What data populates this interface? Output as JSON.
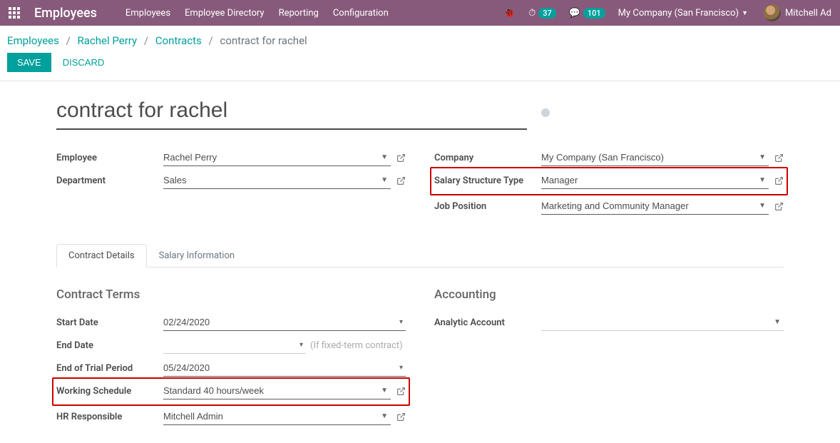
{
  "topbar": {
    "app_title": "Employees",
    "nav": [
      "Employees",
      "Employee Directory",
      "Reporting",
      "Configuration"
    ],
    "clock_count": "37",
    "chat_count": "101",
    "company": "My Company (San Francisco)",
    "user": "Mitchell Ad"
  },
  "breadcrumb": {
    "items": [
      "Employees",
      "Rachel Perry",
      "Contracts"
    ],
    "current": "contract for rachel"
  },
  "actions": {
    "save": "SAVE",
    "discard": "DISCARD"
  },
  "record": {
    "title": "contract for rachel"
  },
  "left_fields": {
    "employee": {
      "label": "Employee",
      "value": "Rachel Perry"
    },
    "department": {
      "label": "Department",
      "value": "Sales"
    }
  },
  "right_fields": {
    "company": {
      "label": "Company",
      "value": "My Company (San Francisco)"
    },
    "salary_structure": {
      "label": "Salary Structure Type",
      "value": "Manager"
    },
    "job_position": {
      "label": "Job Position",
      "value": "Marketing and Community Manager"
    }
  },
  "tabs": {
    "details": "Contract Details",
    "salary": "Salary Information"
  },
  "contract_terms": {
    "heading": "Contract Terms",
    "start_date": {
      "label": "Start Date",
      "value": "02/24/2020"
    },
    "end_date": {
      "label": "End Date",
      "value": "",
      "placeholder": "(If fixed-term contract)"
    },
    "end_trial": {
      "label": "End of Trial Period",
      "value": "05/24/2020"
    },
    "working_schedule": {
      "label": "Working Schedule",
      "value": "Standard 40 hours/week"
    },
    "hr_responsible": {
      "label": "HR Responsible",
      "value": "Mitchell Admin"
    }
  },
  "accounting": {
    "heading": "Accounting",
    "analytic_account": {
      "label": "Analytic Account",
      "value": ""
    }
  }
}
